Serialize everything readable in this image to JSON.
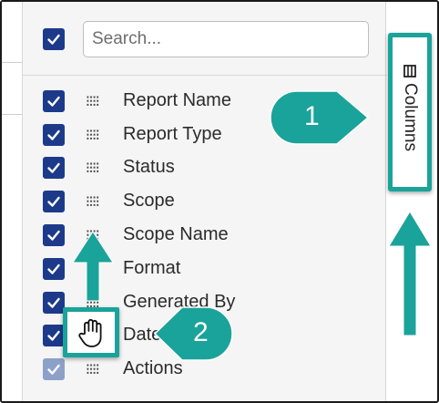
{
  "header": {
    "select_all_checked": true,
    "search_placeholder": "Search..."
  },
  "columns": [
    {
      "label": "Report Name",
      "checked": true
    },
    {
      "label": "Report Type",
      "checked": true
    },
    {
      "label": "Status",
      "checked": true
    },
    {
      "label": "Scope",
      "checked": true
    },
    {
      "label": "Scope Name",
      "checked": true
    },
    {
      "label": "Format",
      "checked": true
    },
    {
      "label": "Generated By",
      "checked": true
    },
    {
      "label": "Date",
      "checked": true
    },
    {
      "label": "Actions",
      "checked": true,
      "disabled": true
    }
  ],
  "side_tab": {
    "label": "Columns",
    "icon": "columns-icon"
  },
  "callouts": [
    {
      "number": "1",
      "icon": "callout-1"
    },
    {
      "number": "2",
      "icon": "callout-2"
    }
  ],
  "colors": {
    "checkbox": "#1d3a8a",
    "checkbox_disabled": "#8da0c8",
    "annotation": "#1aa39a",
    "panel_bg": "#f5f5f5"
  }
}
